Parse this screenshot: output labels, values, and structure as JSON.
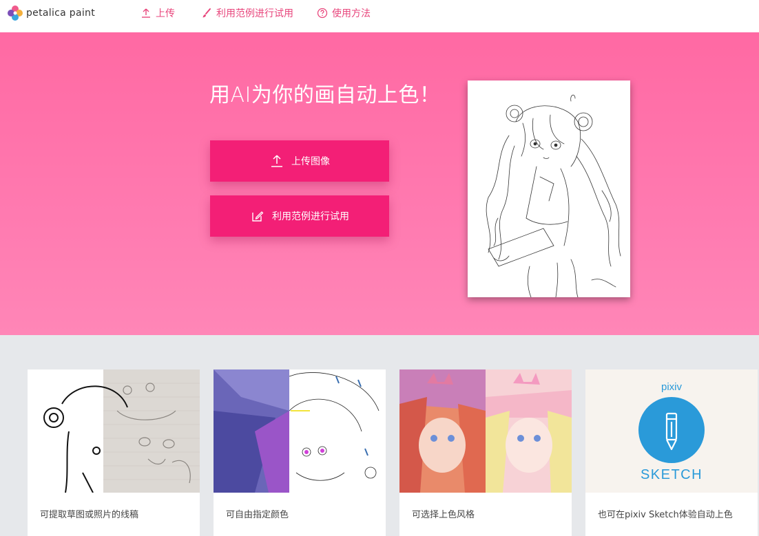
{
  "brand": {
    "name": "petalica paint"
  },
  "nav": {
    "upload": {
      "label": "上传",
      "icon": "upload-icon"
    },
    "sample": {
      "label": "利用范例进行试用",
      "icon": "brush-icon"
    },
    "howto": {
      "label": "使用方法",
      "icon": "question-icon"
    }
  },
  "hero": {
    "title": "用AI为你的画自动上色！",
    "upload_button": "上传图像",
    "sample_button": "利用范例进行试用"
  },
  "features": [
    {
      "caption": "可提取草图或照片的线稿"
    },
    {
      "caption": "可自由指定颜色"
    },
    {
      "caption": "可选择上色风格"
    },
    {
      "caption": "也可在pixiv Sketch体验自动上色",
      "badge_top": "pixiv",
      "badge_bottom": "SKETCH"
    }
  ],
  "colors": {
    "accent": "#f31f76",
    "hero": "#ff69a3",
    "nav_link": "#e8467c",
    "pixiv_blue": "#2a9ad9"
  }
}
